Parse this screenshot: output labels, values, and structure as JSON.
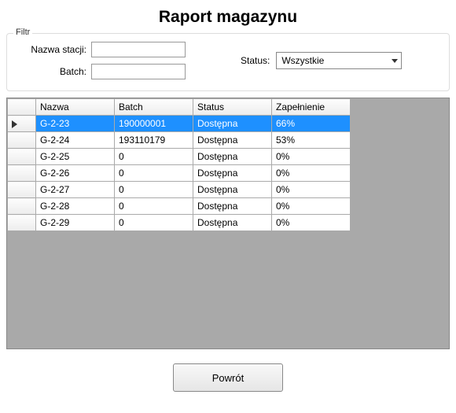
{
  "title": "Raport magazynu",
  "filter": {
    "legend": "Filtr",
    "station_label": "Nazwa stacji:",
    "station_value": "",
    "batch_label": "Batch:",
    "batch_value": "",
    "status_label": "Status:",
    "status_value": "Wszystkie"
  },
  "grid": {
    "headers": {
      "selector": "",
      "name": "Nazwa",
      "batch": "Batch",
      "status": "Status",
      "fill": "Zapełnienie"
    },
    "rows": [
      {
        "name": "G-2-23",
        "batch": "190000001",
        "status": "Dostępna",
        "fill": "66%",
        "selected": true
      },
      {
        "name": "G-2-24",
        "batch": "193110179",
        "status": "Dostępna",
        "fill": "53%",
        "selected": false
      },
      {
        "name": "G-2-25",
        "batch": "0",
        "status": "Dostępna",
        "fill": "0%",
        "selected": false
      },
      {
        "name": "G-2-26",
        "batch": "0",
        "status": "Dostępna",
        "fill": "0%",
        "selected": false
      },
      {
        "name": "G-2-27",
        "batch": "0",
        "status": "Dostępna",
        "fill": "0%",
        "selected": false
      },
      {
        "name": "G-2-28",
        "batch": "0",
        "status": "Dostępna",
        "fill": "0%",
        "selected": false
      },
      {
        "name": "G-2-29",
        "batch": "0",
        "status": "Dostępna",
        "fill": "0%",
        "selected": false
      }
    ]
  },
  "footer": {
    "back_label": "Powrót"
  }
}
